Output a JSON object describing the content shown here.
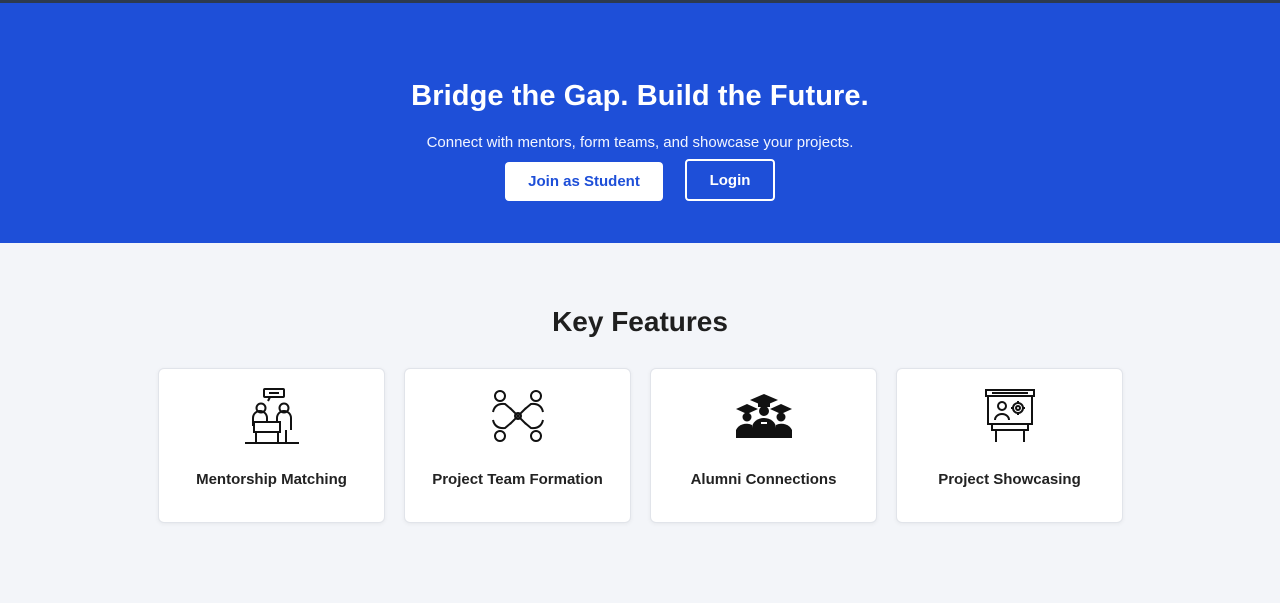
{
  "hero": {
    "title": "Bridge the Gap. Build the Future.",
    "subtitle": "Connect with mentors, form teams, and showcase your projects.",
    "primary_button": "Join as Student",
    "secondary_button": "Login"
  },
  "features": {
    "heading": "Key Features",
    "items": [
      {
        "label": "Mentorship Matching",
        "icon": "mentorship-icon"
      },
      {
        "label": "Project Team Formation",
        "icon": "team-formation-icon"
      },
      {
        "label": "Alumni Connections",
        "icon": "graduates-icon"
      },
      {
        "label": "Project Showcasing",
        "icon": "presentation-icon"
      }
    ]
  },
  "colors": {
    "brand": "#1e4fd8",
    "page_bg": "#f3f5f9",
    "card_bg": "#ffffff"
  }
}
